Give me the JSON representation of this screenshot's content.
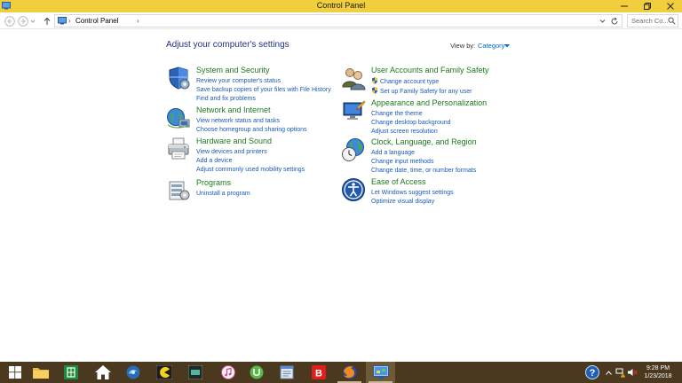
{
  "window": {
    "title": "Control Panel"
  },
  "address_bar": {
    "crumb": "Control Panel",
    "sep1": "›",
    "sep2": "›"
  },
  "search": {
    "placeholder": "Search Co..."
  },
  "content": {
    "heading": "Adjust your computer's settings",
    "view_by_label": "View by:",
    "view_by_value": "Category"
  },
  "categories": [
    {
      "title": "System and Security",
      "icon": "shield-icon",
      "links": [
        "Review your computer's status",
        "Save backup copies of your files with File History",
        "Find and fix problems"
      ]
    },
    {
      "title": "Network and Internet",
      "icon": "network-globe-icon",
      "links": [
        "View network status and tasks",
        "Choose homegroup and sharing options"
      ]
    },
    {
      "title": "Hardware and Sound",
      "icon": "printer-icon",
      "links": [
        "View devices and printers",
        "Add a device",
        "Adjust commonly used mobility settings"
      ]
    },
    {
      "title": "Programs",
      "icon": "programs-icon",
      "links": [
        "Uninstall a program"
      ]
    },
    {
      "title": "User Accounts and Family Safety",
      "icon": "users-icon",
      "links": [
        "Change account type",
        "Set up Family Safety for any user"
      ]
    },
    {
      "title": "Appearance and Personalization",
      "icon": "monitor-paint-icon",
      "links": [
        "Change the theme",
        "Change desktop background",
        "Adjust screen resolution"
      ]
    },
    {
      "title": "Clock, Language, and Region",
      "icon": "globe-clock-icon",
      "links": [
        "Add a language",
        "Change input methods",
        "Change date, time, or number formats"
      ]
    },
    {
      "title": "Ease of Access",
      "icon": "ease-of-access-icon",
      "links": [
        "Let Windows suggest settings",
        "Optimize visual display"
      ]
    }
  ],
  "taskbar": {
    "apps": [
      "start-icon",
      "file-explorer-icon",
      "excel-icon",
      "home-icon",
      "browser-icon",
      "pacman-icon",
      "media-icon",
      "itunes-icon",
      "utorrent-icon",
      "notepad-icon",
      "bitdefender-icon",
      "firefox-icon",
      "control-panel-icon"
    ],
    "time": "9:28 PM",
    "date": "1/23/2018"
  },
  "colors": {
    "titlebar": "#f0ce3c",
    "taskbar": "#4a391f",
    "heading": "#1e3287",
    "category_title": "#1d7a1d",
    "link": "#1a5ab8"
  }
}
